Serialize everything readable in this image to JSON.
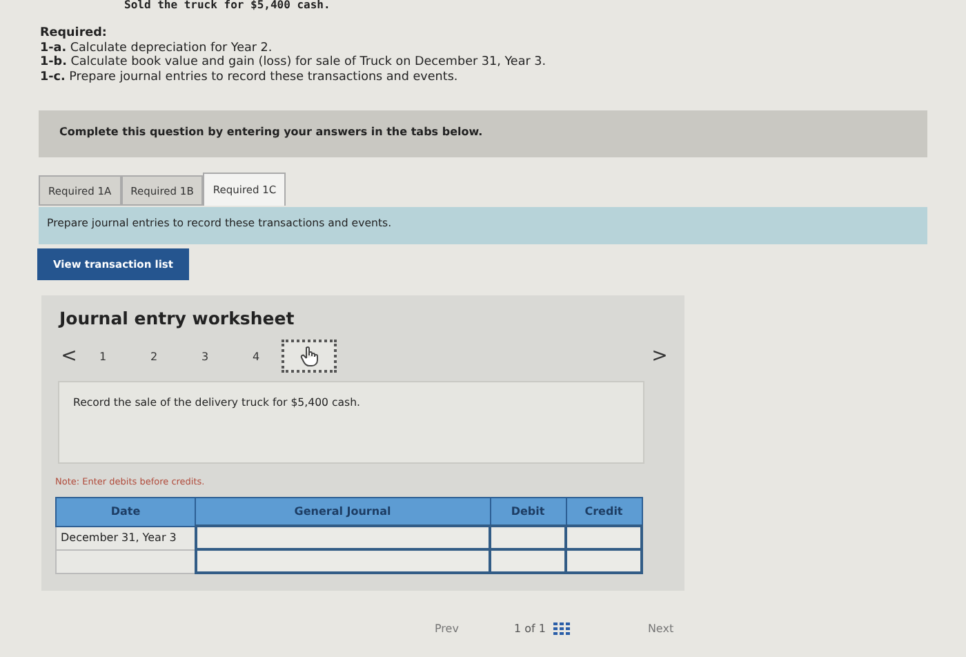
{
  "problem_line": "Sold the truck for $5,400 cash.",
  "required": {
    "heading": "Required:",
    "items": [
      {
        "tag": "1-a.",
        "text": "Calculate depreciation for Year 2."
      },
      {
        "tag": "1-b.",
        "text": "Calculate book value and gain (loss) for sale of Truck on December 31, Year 3."
      },
      {
        "tag": "1-c.",
        "text": "Prepare journal entries to record these transactions and events."
      }
    ]
  },
  "banner": "Complete this question by entering your answers in the tabs below.",
  "tabs": [
    {
      "label": "Required 1A",
      "selected": false
    },
    {
      "label": "Required 1B",
      "selected": false
    },
    {
      "label": "Required 1C",
      "selected": true
    }
  ],
  "instruction": "Prepare journal entries to record these transactions and events.",
  "view_button": "View transaction list",
  "worksheet": {
    "title": "Journal entry worksheet",
    "prev": "<",
    "next": ">",
    "steps": [
      {
        "kind": "number",
        "label": "1",
        "selected": false
      },
      {
        "kind": "number",
        "label": "2",
        "selected": false
      },
      {
        "kind": "number",
        "label": "3",
        "selected": false
      },
      {
        "kind": "number",
        "label": "4",
        "selected": false
      },
      {
        "kind": "pointer",
        "selected": true
      }
    ],
    "description": "Record the sale of the delivery truck for $5,400 cash.",
    "note": "Note: Enter debits before credits.",
    "table": {
      "columns": [
        "Date",
        "General Journal",
        "Debit",
        "Credit"
      ],
      "rows": [
        {
          "date": "December 31, Year 3"
        },
        {
          "date": ""
        }
      ]
    }
  },
  "pagination": {
    "prev": "Prev",
    "page": "1 of 1",
    "next": "Next"
  }
}
